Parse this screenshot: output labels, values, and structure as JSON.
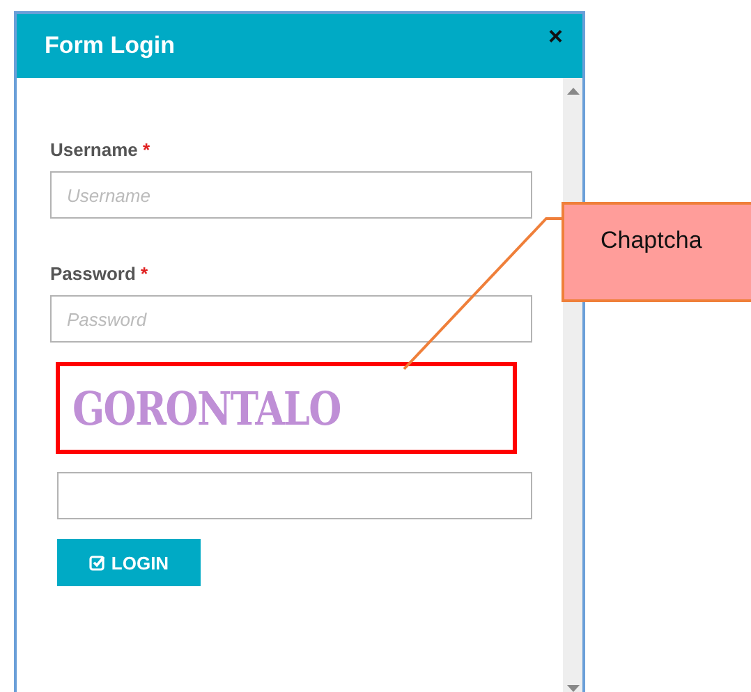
{
  "dialog": {
    "title": "Form Login",
    "close": "×"
  },
  "fields": [
    {
      "label": "Username",
      "required": "*",
      "placeholder": "Username"
    },
    {
      "label": "Password",
      "required": "*",
      "placeholder": "Password"
    }
  ],
  "captcha": {
    "text": "GORONTALO"
  },
  "button": {
    "label": "LOGIN"
  },
  "callout": {
    "text": "Chaptcha"
  }
}
